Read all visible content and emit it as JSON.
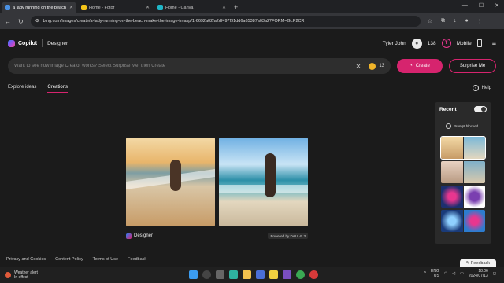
{
  "browser": {
    "tabs": [
      {
        "title": "a lady running on the beach m",
        "active": true,
        "favicon_color": "#4a90e2"
      },
      {
        "title": "Home - Fotor",
        "active": false,
        "favicon_color": "#f5c518"
      },
      {
        "title": "Home - Canva",
        "active": false,
        "favicon_color": "#1fb6c7"
      }
    ],
    "new_tab": "+",
    "url": "bing.com/images/create/a-lady-running-on-the-beach-make-the-image-in-asp/1-6692a02fa2df497f91dd6a65387a03a2?FORM=GLP2CR"
  },
  "header": {
    "brand": "Copilot",
    "section": "Designer",
    "user_name": "Tyler John",
    "reward_points": "138",
    "mobile_label": "Mobile"
  },
  "search": {
    "placeholder": "Want to see how Image Creator works? Select Surprise Me, then Create",
    "boosts": "13",
    "create_label": "Create",
    "surprise_label": "Surprise Me"
  },
  "subnav": {
    "explore": "Explore ideas",
    "creations": "Creations",
    "help": "Help"
  },
  "results": {
    "brand_label": "Designer",
    "powered_by": "Powered by DALL·E 3"
  },
  "recent": {
    "title": "Recent",
    "blocked_label": "Prompt blocked",
    "thumbs": [
      {
        "left": "#d9b57a",
        "right": "#7ab8d8",
        "selected": true
      },
      {
        "left": "#e8d2c2",
        "right": "#7fb0c9",
        "selected": false
      },
      {
        "left": "#1c2f6e",
        "right": "#ffffff",
        "selected": false
      },
      {
        "left": "#1a3b7a",
        "right": "#2d7ccf",
        "selected": false
      }
    ]
  },
  "footer": {
    "links": [
      "Privacy and Cookies",
      "Content Policy",
      "Terms of Use",
      "Feedback"
    ],
    "feedback_button": "Feedback"
  },
  "taskbar": {
    "weather_title": "Weather alert",
    "weather_sub": "In effect",
    "lang_top": "ENG",
    "lang_bottom": "US",
    "time": "18:06",
    "date": "2024/07/13"
  }
}
